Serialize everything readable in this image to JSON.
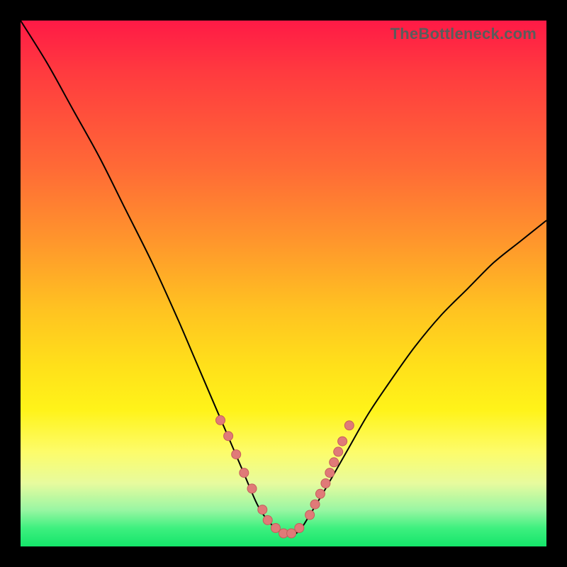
{
  "watermark": "TheBottleneck.com",
  "colors": {
    "frame": "#000000",
    "curve": "#000000",
    "dot_fill": "#e07a78",
    "dot_stroke": "#c55d5b",
    "gradient_stops": [
      "#ff1a46",
      "#ff3b3f",
      "#ff6a36",
      "#ff962c",
      "#ffc321",
      "#ffe11a",
      "#fff319",
      "#fdfc6a",
      "#e7fb9e",
      "#9af6a3",
      "#3ef07f",
      "#14e56a"
    ]
  },
  "chart_data": {
    "type": "line",
    "title": "",
    "xlabel": "",
    "ylabel": "",
    "xlim": [
      0,
      100
    ],
    "ylim": [
      0,
      100
    ],
    "x": [
      0,
      5,
      10,
      15,
      20,
      25,
      30,
      33,
      36,
      39,
      42,
      45,
      47,
      49,
      51,
      53,
      55,
      58,
      62,
      66,
      70,
      75,
      80,
      85,
      90,
      95,
      100
    ],
    "y": [
      100,
      92,
      83,
      74,
      64,
      54,
      43,
      36,
      29,
      22,
      15,
      8,
      5,
      3,
      2,
      3,
      6,
      11,
      18,
      25,
      31,
      38,
      44,
      49,
      54,
      58,
      62
    ],
    "series": [
      {
        "name": "bottleneck-curve",
        "x": [
          0,
          5,
          10,
          15,
          20,
          25,
          30,
          33,
          36,
          39,
          42,
          45,
          47,
          49,
          51,
          53,
          55,
          58,
          62,
          66,
          70,
          75,
          80,
          85,
          90,
          95,
          100
        ],
        "y": [
          100,
          92,
          83,
          74,
          64,
          54,
          43,
          36,
          29,
          22,
          15,
          8,
          5,
          3,
          2,
          3,
          6,
          11,
          18,
          25,
          31,
          38,
          44,
          49,
          54,
          58,
          62
        ]
      }
    ],
    "markers": {
      "name": "highlighted-points",
      "x": [
        38,
        39.5,
        41,
        42.5,
        44,
        46,
        47,
        48.5,
        50,
        51.5,
        53,
        55,
        56,
        57,
        58,
        58.8,
        59.6,
        60.4,
        61.2,
        62.5
      ],
      "y": [
        24,
        21,
        17.5,
        14,
        11,
        7,
        5,
        3.5,
        2.5,
        2.5,
        3.5,
        6,
        8,
        10,
        12,
        14,
        16,
        18,
        20,
        23
      ]
    },
    "notes": "V-shaped bottleneck curve on rainbow heat gradient. Minimum near x≈50, y≈2. Salmon dots cluster along the curve in the green band (roughly y < 25)."
  }
}
